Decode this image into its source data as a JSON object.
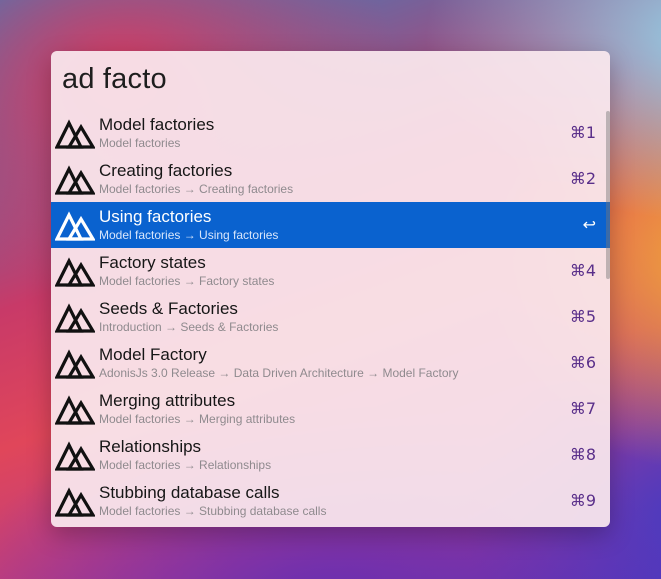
{
  "search": {
    "query": "ad facto"
  },
  "results": [
    {
      "title": "Model factories",
      "subtitle": "Model factories",
      "shortcut": "⌘1",
      "icon": "adonisjs-logo-icon",
      "selected": false
    },
    {
      "title": "Creating factories",
      "subtitle": "Model factories → Creating factories",
      "shortcut": "⌘2",
      "icon": "adonisjs-logo-icon",
      "selected": false
    },
    {
      "title": "Using factories",
      "subtitle": "Model factories → Using factories",
      "shortcut": "↩",
      "icon": "adonisjs-logo-icon",
      "selected": true
    },
    {
      "title": "Factory states",
      "subtitle": "Model factories → Factory states",
      "shortcut": "⌘4",
      "icon": "adonisjs-logo-icon",
      "selected": false
    },
    {
      "title": "Seeds & Factories",
      "subtitle": "Introduction → Seeds & Factories",
      "shortcut": "⌘5",
      "icon": "adonisjs-logo-icon",
      "selected": false
    },
    {
      "title": "Model Factory",
      "subtitle": "AdonisJs 3.0 Release → Data Driven Architecture → Model Factory",
      "shortcut": "⌘6",
      "icon": "adonisjs-logo-icon",
      "selected": false
    },
    {
      "title": "Merging attributes",
      "subtitle": "Model factories → Merging attributes",
      "shortcut": "⌘7",
      "icon": "adonisjs-logo-icon",
      "selected": false
    },
    {
      "title": "Relationships",
      "subtitle": "Model factories → Relationships",
      "shortcut": "⌘8",
      "icon": "adonisjs-logo-icon",
      "selected": false
    },
    {
      "title": "Stubbing database calls",
      "subtitle": "Model factories → Stubbing database calls",
      "shortcut": "⌘9",
      "icon": "adonisjs-logo-icon",
      "selected": false
    }
  ],
  "colors": {
    "selection": "#0a62cf",
    "shortcut": "#5a2f8a",
    "subtitle": "#8f8a8e"
  }
}
